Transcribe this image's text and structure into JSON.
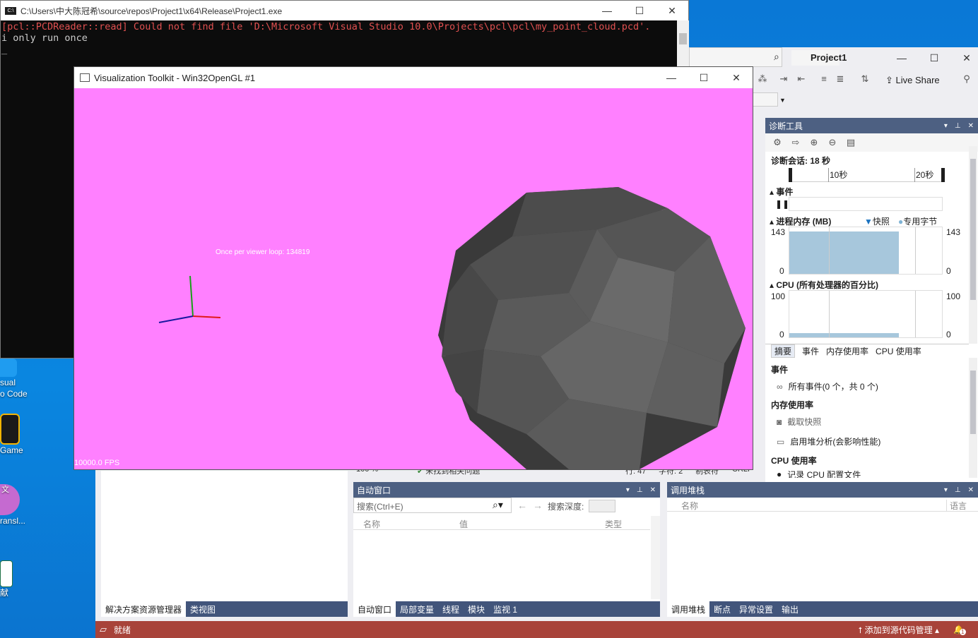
{
  "console": {
    "title": "C:\\Users\\中大陈冠希\\source\\repos\\Project1\\x64\\Release\\Project1.exe",
    "line1": "[pcl::PCDReader::read] Could not find file 'D:\\Microsoft Visual Studio 10.0\\Projects\\pcl\\pcl\\my_point_cloud.pcd'.",
    "line2": "i only run once",
    "cursor": "_"
  },
  "vtk": {
    "title": "Visualization Toolkit - Win32OpenGL #1",
    "overlay_text": "Once per viewer loop: 134819",
    "fps": "10000.0 FPS",
    "background": "#ff80ff"
  },
  "desktop": {
    "icons": [
      {
        "label1": "sual",
        "label2": "o Code"
      },
      {
        "label1": "Game",
        "label2": ""
      },
      {
        "label1": "文",
        "label2": "ransl..."
      },
      {
        "label1": "献",
        "label2": ""
      }
    ]
  },
  "vs": {
    "project": "Project1",
    "live_share": "Live Share",
    "diag": {
      "title": "诊断工具",
      "session": "诊断会话: 18 秒",
      "tick_10": "10秒",
      "tick_20": "20秒",
      "events_head": "事件",
      "memory_head": "进程内存 (MB)",
      "legend_snapshot": "快照",
      "legend_private": "专用字节",
      "mem_max_left": "143",
      "mem_min_left": "0",
      "mem_max_right": "143",
      "mem_min_right": "0",
      "cpu_head": "CPU (所有处理器的百分比)",
      "cpu_max_left": "100",
      "cpu_min_left": "0",
      "cpu_max_right": "100",
      "cpu_min_right": "0",
      "tabs": [
        "摘要",
        "事件",
        "内存使用率",
        "CPU 使用率"
      ],
      "events_section": "事件",
      "all_events": "所有事件(0 个，共 0 个)",
      "memory_section": "内存使用率",
      "snapshot": "截取快照",
      "heap": "启用堆分析(会影响性能)",
      "cpu_section": "CPU 使用率",
      "cpu_record": "记录 CPU 配置文件"
    },
    "editor_status": {
      "zoom": "100 %",
      "issues": "未找到相关问题",
      "line": "行: 47",
      "char": "字符: 2",
      "tabs": "制表符",
      "eol": "CRLF"
    },
    "autos": {
      "title": "自动窗口",
      "search_placeholder": "搜索(Ctrl+E)",
      "depth_label": "搜索深度:",
      "col_name": "名称",
      "col_value": "值",
      "col_type": "类型",
      "tabs": [
        "自动窗口",
        "局部变量",
        "线程",
        "模块",
        "监视 1"
      ]
    },
    "callstack": {
      "title": "调用堆栈",
      "col_name": "名称",
      "col_lang": "语言",
      "tabs": [
        "调用堆栈",
        "断点",
        "异常设置",
        "输出"
      ]
    },
    "solution": {
      "tabs": [
        "解决方案资源管理器",
        "类视图"
      ]
    },
    "statusbar": {
      "ready": "就绪",
      "source_control": "添加到源代码管理",
      "notif": "1"
    }
  },
  "colors": {
    "vs_panel_title": "#4d6082",
    "status_bar": "#a8433a",
    "console_error": "#e05050",
    "sphere_dark": "#3a3a3a"
  }
}
